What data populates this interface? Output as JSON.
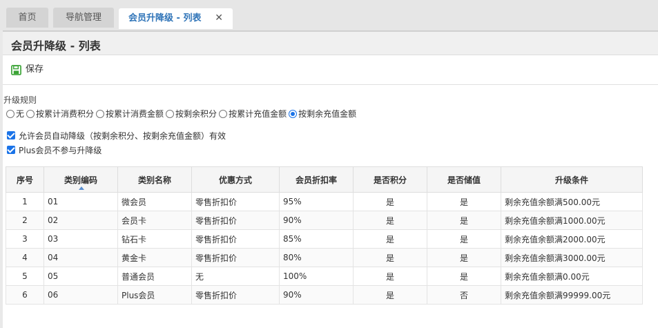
{
  "tabs": [
    {
      "label": "首页"
    },
    {
      "label": "导航管理"
    },
    {
      "label": "会员升降级 - 列表",
      "close": "✕"
    }
  ],
  "page": {
    "title": "会员升降级 - 列表",
    "save_label": "保存"
  },
  "rules": {
    "label": "升级规则",
    "options": [
      "无",
      "按累计消费积分",
      "按累计消费金额",
      "按剩余积分",
      "按累计充值金额",
      "按剩余充值金额"
    ],
    "selected": "按剩余充值金额"
  },
  "checks": [
    {
      "label": "允许会员自动降级（按剩余积分、按剩余充值金额）有效",
      "checked": true
    },
    {
      "label": "Plus会员不参与升降级",
      "checked": true
    }
  ],
  "table": {
    "headers": [
      "序号",
      "类别编码",
      "类别名称",
      "优惠方式",
      "会员折扣率",
      "是否积分",
      "是否储值",
      "升级条件"
    ],
    "rows": [
      [
        "1",
        "01",
        "微会员",
        "零售折扣价",
        "95%",
        "是",
        "是",
        "剩余充值余额满500.00元"
      ],
      [
        "2",
        "02",
        "会员卡",
        "零售折扣价",
        "90%",
        "是",
        "是",
        "剩余充值余额满1000.00元"
      ],
      [
        "3",
        "03",
        "钻石卡",
        "零售折扣价",
        "85%",
        "是",
        "是",
        "剩余充值余额满2000.00元"
      ],
      [
        "4",
        "04",
        "黄金卡",
        "零售折扣价",
        "80%",
        "是",
        "是",
        "剩余充值余额满3000.00元"
      ],
      [
        "5",
        "05",
        "普通会员",
        "无",
        "100%",
        "是",
        "是",
        "剩余充值余额满0.00元"
      ],
      [
        "6",
        "06",
        "Plus会员",
        "零售折扣价",
        "90%",
        "是",
        "否",
        "剩余充值余额满99999.00元"
      ]
    ]
  },
  "colors": {
    "accent": "#2f74b8",
    "save_icon": "#3aa335"
  },
  "icons": {
    "save": "save-icon",
    "close": "close-icon",
    "sort": "sort-asc-icon"
  }
}
